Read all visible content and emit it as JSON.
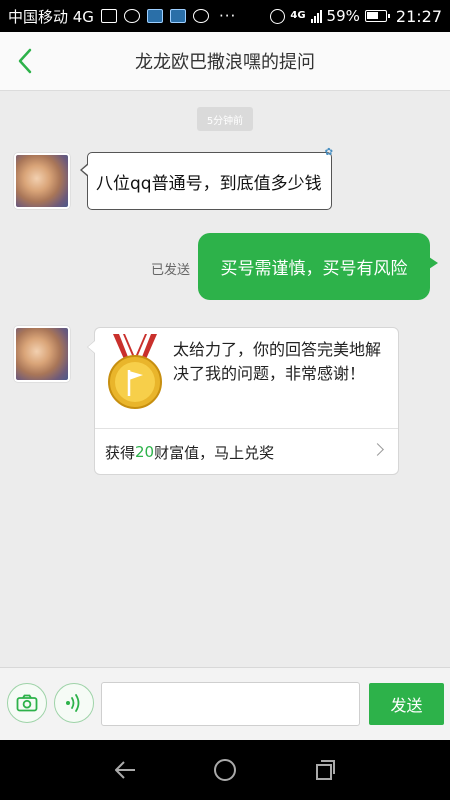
{
  "status_bar": {
    "carrier": "中国移动 4G",
    "icons": [
      "mail-icon",
      "wechat-icon",
      "app-icon-1",
      "app-icon-2",
      "record-icon",
      "more-icon"
    ],
    "more": "···",
    "net_label": "4G",
    "battery": "59%",
    "time": "21:27"
  },
  "header": {
    "title": "龙龙欧巴撒浪嘿的提问"
  },
  "chat": {
    "time_separator": "5分钟前",
    "question": "八位qq普通号，到底值多少钱",
    "sent_status": "已发送",
    "answer": "买号需谨慎，买号有风险",
    "reward_card": {
      "message": "太给力了，你的回答完美地解决了我的问题，非常感谢！",
      "footer_prefix": "获得",
      "footer_number": "20",
      "footer_suffix": "财富值，马上兑奖"
    }
  },
  "input_bar": {
    "input_value": "",
    "send_label": "发送"
  },
  "colors": {
    "accent": "#2db24a",
    "header_bg": "#fafafa",
    "chat_bg": "#ececec"
  }
}
